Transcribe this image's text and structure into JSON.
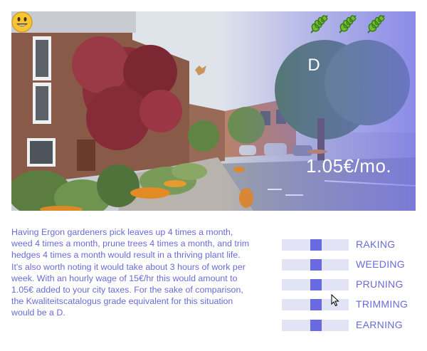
{
  "scene": {
    "grade": "D",
    "price": "1.05€/mo.",
    "face_icon": "smiley-face-icon",
    "leaf_icon": "leaf-icon",
    "leaf_count": 3,
    "colors": {
      "overlay": "#6e6ee6",
      "text": "#ffffff"
    }
  },
  "description": "Having Ergon gardeners pick leaves up 4 times a month, weed 4 times a month, prune trees 4 times a month, and trim hedges 4 times a month would result in a thriving plant life. It's also worth noting it would take about 3 hours of work per week. With an hourly wage of 15€/hr this would amount to 1.05€ added to your city taxes. For the sake of comparison, the Kwaliteitscatalogus grade equivalent for this situation would be a D.",
  "sliders": [
    {
      "label": "RAKING",
      "value": 0.5
    },
    {
      "label": "WEEDING",
      "value": 0.5
    },
    {
      "label": "PRUNING",
      "value": 0.5
    },
    {
      "label": "TRIMMING",
      "value": 0.5
    },
    {
      "label": "EARNING",
      "value": 0.5
    }
  ],
  "colors": {
    "accent": "#6a6ae0",
    "track": "#e3e3f6",
    "text": "#6a6ad8"
  }
}
